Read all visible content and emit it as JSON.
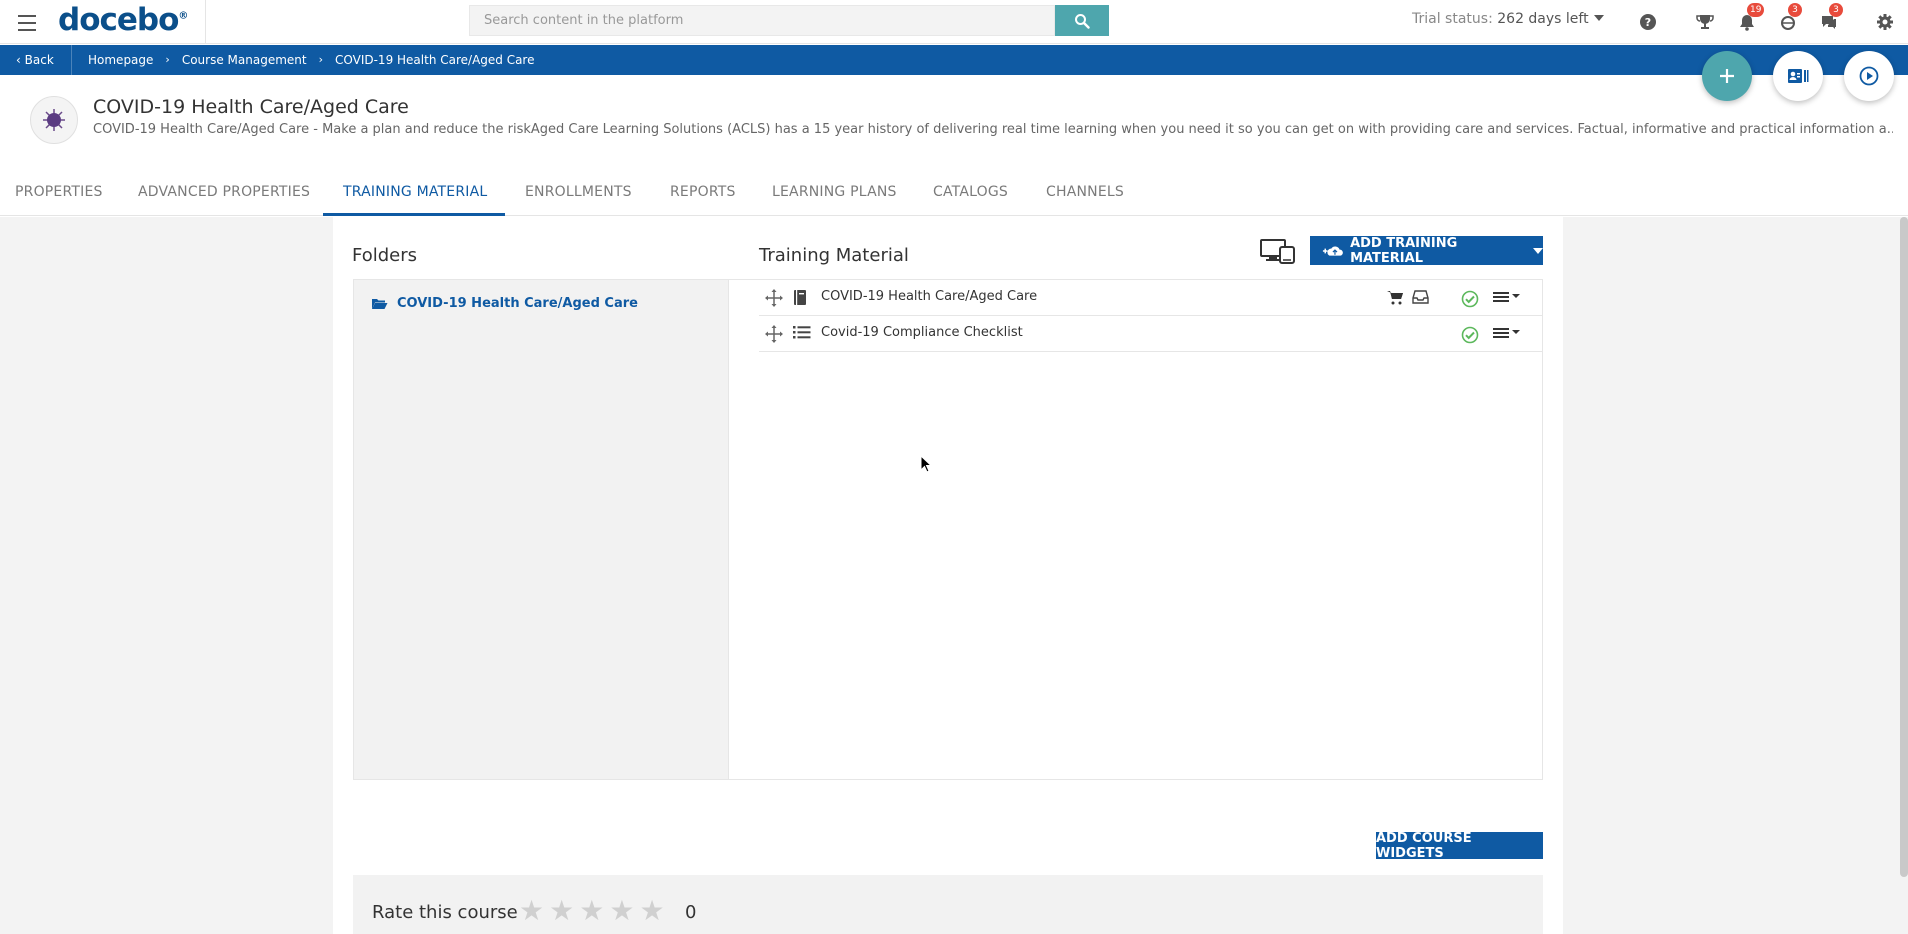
{
  "topbar": {
    "logo": "docebo",
    "logo_mark": "®",
    "search_placeholder": "Search content in the platform",
    "trial_prefix": "Trial status:",
    "trial_value": "262 days left",
    "badges": {
      "notifications": "19",
      "gamification": "3",
      "messages": "3"
    }
  },
  "breadcrumb": {
    "back_label": "Back",
    "items": [
      "Homepage",
      "Course Management",
      "COVID-19 Health Care/Aged Care"
    ]
  },
  "course": {
    "title": "COVID-19 Health Care/Aged Care",
    "description": "COVID-19 Health Care/Aged Care - Make a plan and reduce the riskAged Care Learning Solutions (ACLS) has a 15 year history of delivering real time learning when you need it so you can get on with providing care and services. Factual, informative and practical information a..."
  },
  "tabs": [
    "PROPERTIES",
    "ADVANCED PROPERTIES",
    "TRAINING MATERIAL",
    "ENROLLMENTS",
    "REPORTS",
    "LEARNING PLANS",
    "CATALOGS",
    "CHANNELS"
  ],
  "active_tab": "TRAINING MATERIAL",
  "folders": {
    "title": "Folders",
    "items": [
      "COVID-19 Health Care/Aged Care"
    ]
  },
  "training_material": {
    "title": "Training Material",
    "add_button": "ADD TRAINING MATERIAL",
    "items": [
      {
        "name": "COVID-19 Health Care/Aged Care",
        "type_icon": "book-icon",
        "ecommerce": true,
        "status": "published"
      },
      {
        "name": "Covid-19 Compliance Checklist",
        "type_icon": "list-icon",
        "ecommerce": false,
        "status": "published"
      }
    ]
  },
  "widgets_button": "ADD COURSE WIDGETS",
  "rating": {
    "label": "Rate this course",
    "stars": 5,
    "count": "0"
  },
  "colors": {
    "primary": "#0f5aa3",
    "accent": "#4ea6ad",
    "badge": "#e84b3c",
    "success": "#5cb85c"
  }
}
